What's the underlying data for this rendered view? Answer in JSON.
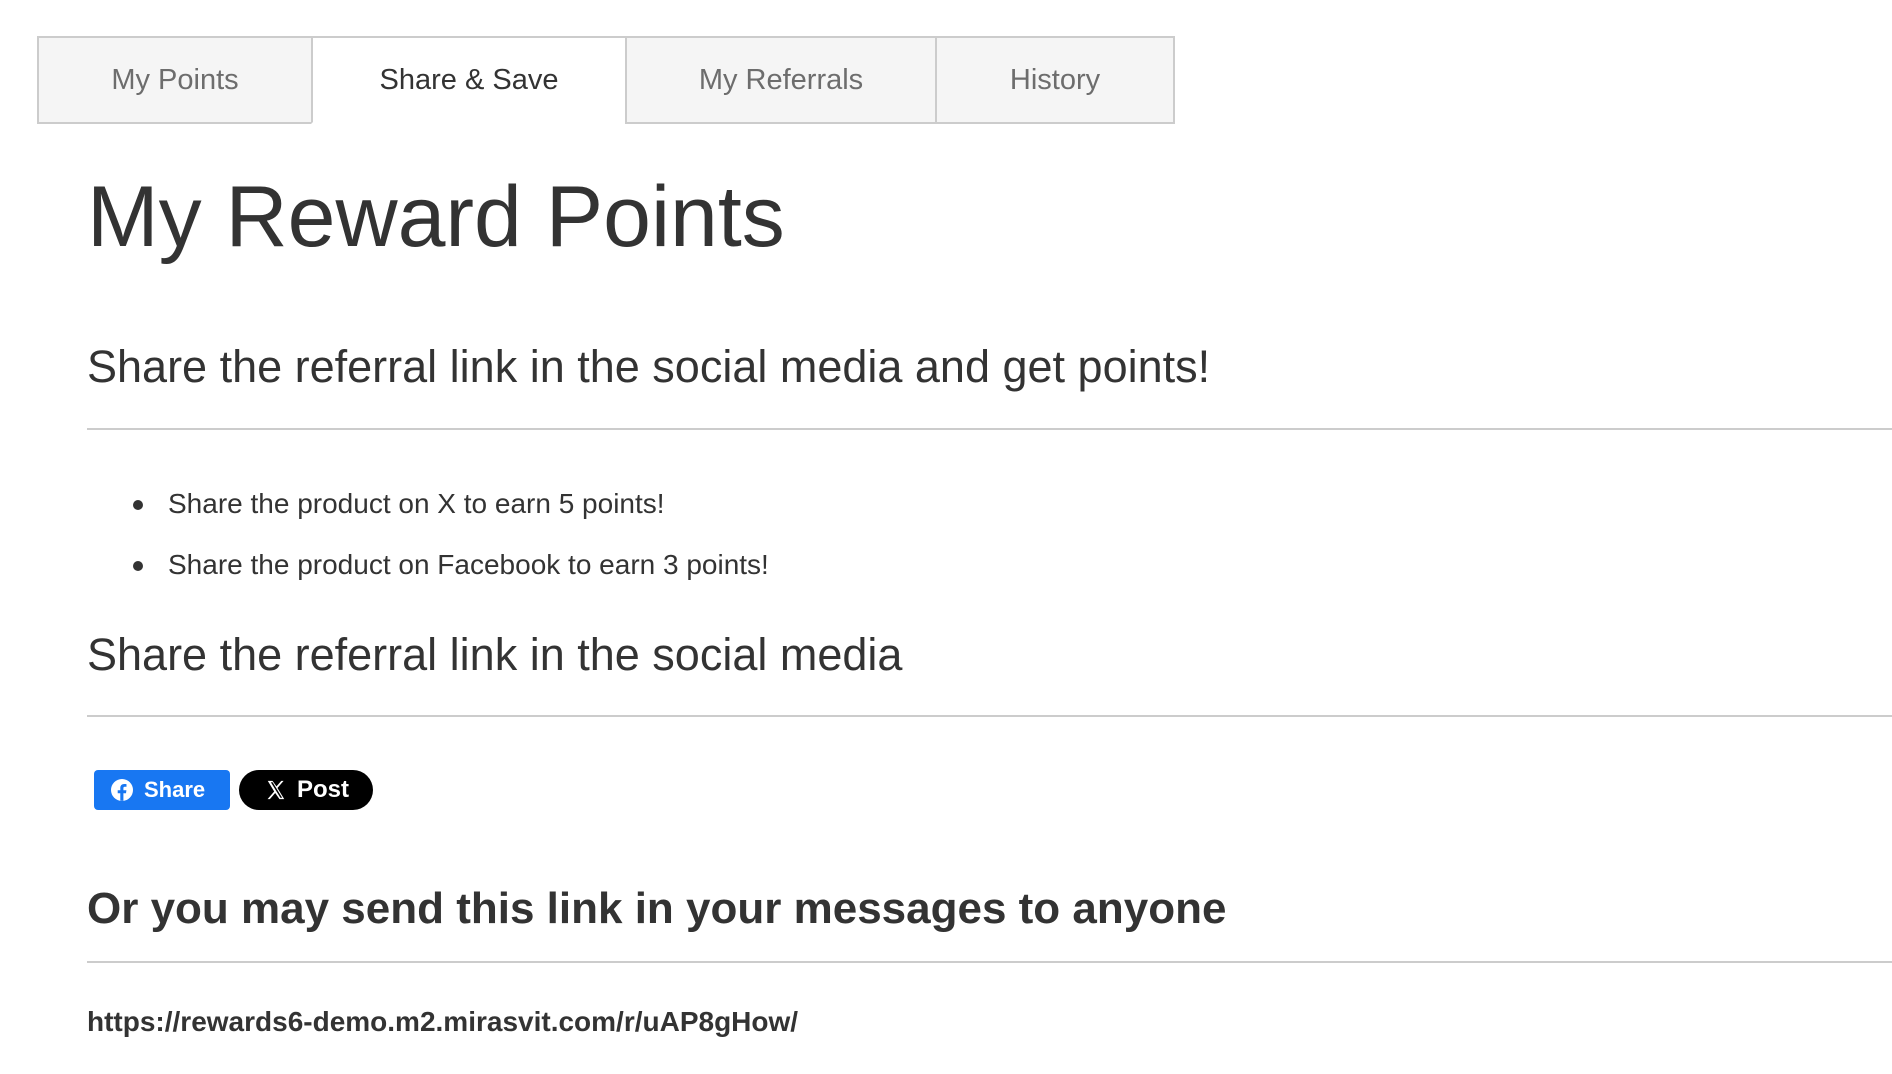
{
  "tabs": [
    {
      "label": "My Points",
      "active": false
    },
    {
      "label": "Share & Save",
      "active": true
    },
    {
      "label": "My Referrals",
      "active": false
    },
    {
      "label": "History",
      "active": false
    }
  ],
  "page_title": "My Reward Points",
  "sections": {
    "rules_heading": "Share the referral link in the social media and get points!",
    "rules": [
      "Share the product on X to earn 5 points!",
      "Share the product on Facebook to earn 3 points!"
    ],
    "social_heading": "Share the referral link in the social media",
    "social_buttons": {
      "facebook_label": "Share",
      "x_label": "Post"
    },
    "message_heading": "Or you may send this link in your messages to anyone",
    "referral_link": "https://rewards6-demo.m2.mirasvit.com/r/uAP8gHow/"
  },
  "colors": {
    "facebook": "#1877f2",
    "x": "#000000",
    "text": "#333333",
    "tab_border": "#cccccc",
    "tab_background": "#f5f5f5"
  },
  "icons": {
    "facebook": "facebook-icon",
    "x": "x-logo-icon"
  }
}
